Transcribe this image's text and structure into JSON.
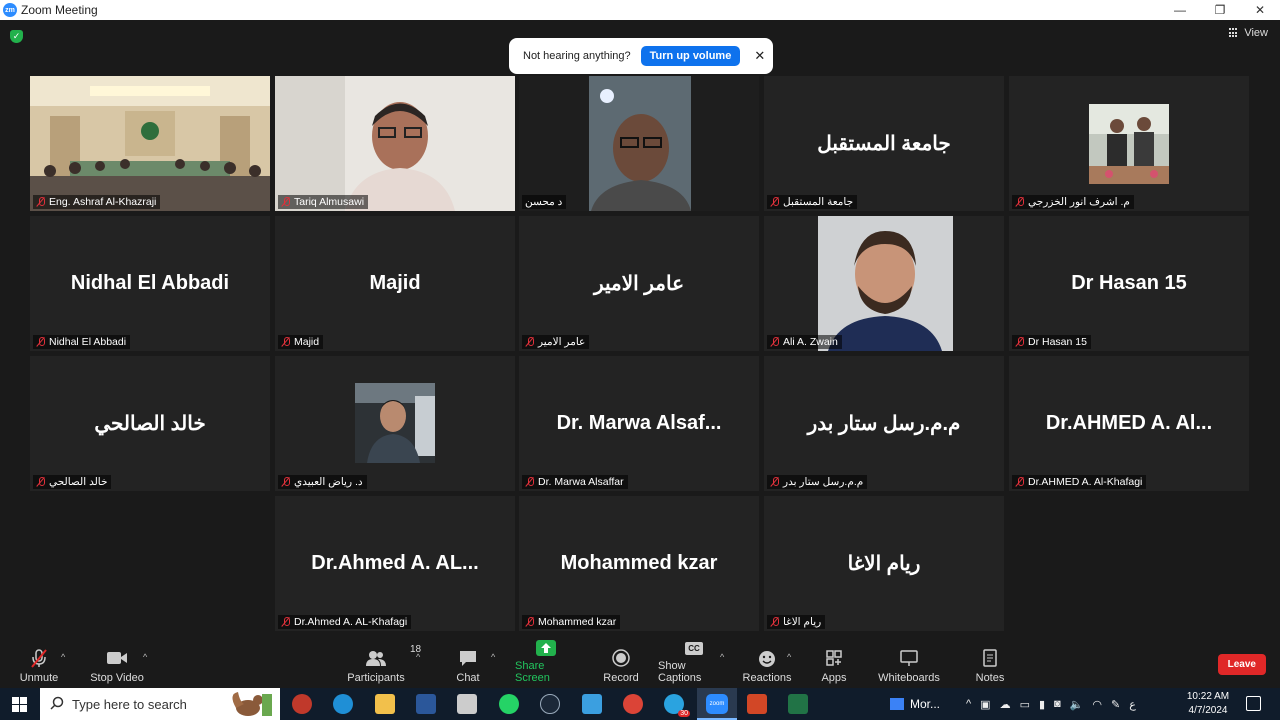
{
  "window": {
    "title": "Zoom Meeting",
    "app_icon_text": "zm",
    "minimize": "—",
    "maximize": "❐",
    "close": "✕"
  },
  "stage": {
    "view_label": "View",
    "notice": {
      "text": "Not hearing anything?",
      "button": "Turn up volume",
      "close": "✕"
    }
  },
  "tiles": [
    {
      "label": "Eng. Ashraf Al-Khazraji",
      "big": ""
    },
    {
      "label": "Tariq Almusawi",
      "big": ""
    },
    {
      "label": "د محسن",
      "big": ""
    },
    {
      "label": "جامعة المستقبل",
      "big": "جامعة المستقبل"
    },
    {
      "label": "م. اشرف انور الخزرجي",
      "big": ""
    },
    {
      "label": "Nidhal El Abbadi",
      "big": "Nidhal El Abbadi"
    },
    {
      "label": "Majid",
      "big": "Majid"
    },
    {
      "label": "عامر الامير",
      "big": "عامر الامير"
    },
    {
      "label": "Ali A. Zwain",
      "big": ""
    },
    {
      "label": "Dr Hasan 15",
      "big": "Dr Hasan 15"
    },
    {
      "label": "خالد الصالحي",
      "big": "خالد الصالحي"
    },
    {
      "label": "د. رياض العبيدي",
      "big": ""
    },
    {
      "label": "Dr. Marwa Alsaffar",
      "big": "Dr. Marwa Alsaf..."
    },
    {
      "label": "م.م.رسل ستار بدر",
      "big": "م.م.رسل ستار بدر"
    },
    {
      "label": "Dr.AHMED A. Al-Khafagi",
      "big": "Dr.AHMED A. Al..."
    },
    {
      "label": "Dr.Ahmed A. AL-Khafagi",
      "big": "Dr.Ahmed A. AL..."
    },
    {
      "label": "Mohammed  kzar",
      "big": "Mohammed  kzar"
    },
    {
      "label": "ريام الاغا",
      "big": "ريام الاغا"
    }
  ],
  "toolbar": {
    "unmute": "Unmute",
    "stop_video": "Stop Video",
    "participants": "Participants",
    "participants_count": "18",
    "chat": "Chat",
    "share_screen": "Share Screen",
    "record": "Record",
    "show_captions": "Show Captions",
    "cc": "CC",
    "reactions": "Reactions",
    "apps": "Apps",
    "whiteboards": "Whiteboards",
    "notes": "Notes",
    "leave": "Leave"
  },
  "taskbar": {
    "search_placeholder": "Type here to search",
    "task_label": "Mor...",
    "time": "10:22 AM",
    "date": "4/7/2024",
    "lang": "ع",
    "badge": "30",
    "zoom_label": "zoom"
  },
  "colors": {
    "accent_blue": "#0e72ed",
    "share_green": "#22b14c",
    "leave_red": "#e02828",
    "active_border": "#c8e85a"
  }
}
